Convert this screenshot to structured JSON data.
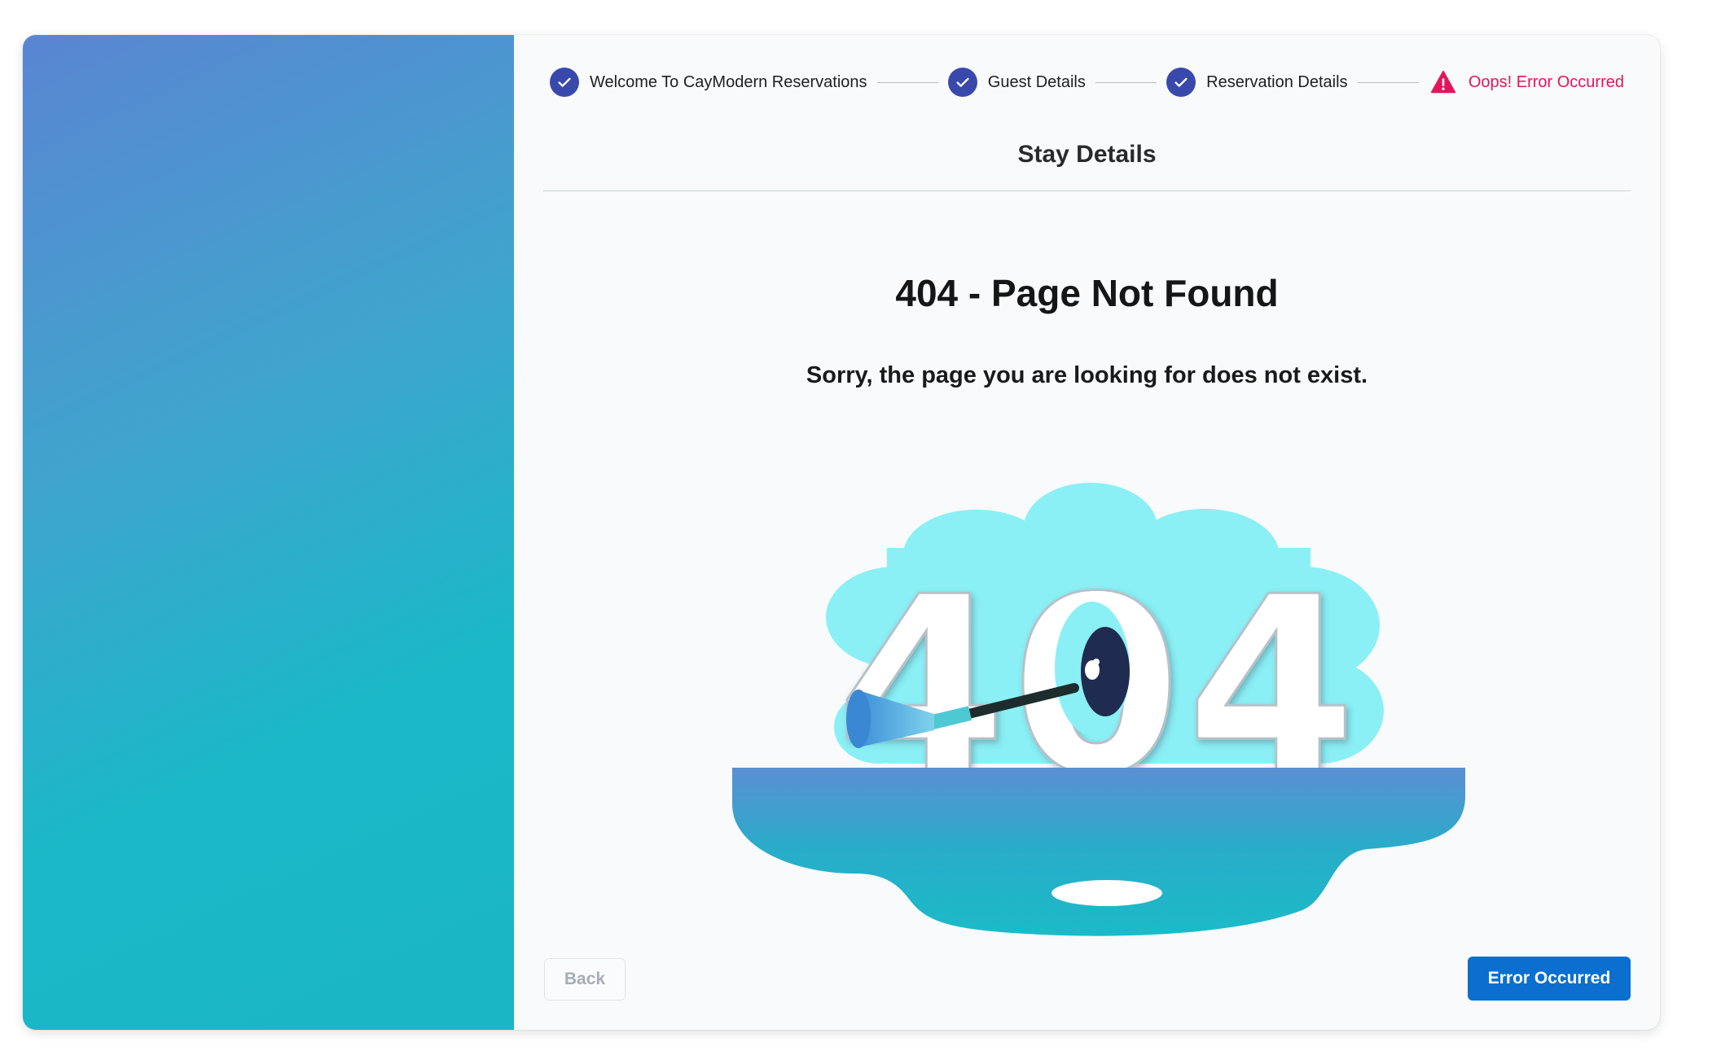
{
  "stepper": {
    "steps": [
      {
        "label": "Welcome To CayModern Reservations",
        "status": "complete",
        "icon": "check-icon"
      },
      {
        "label": "Guest Details",
        "status": "complete",
        "icon": "check-icon"
      },
      {
        "label": "Reservation Details",
        "status": "complete",
        "icon": "check-icon"
      },
      {
        "label": "Oops! Error Occurred",
        "status": "error",
        "icon": "warning-icon"
      }
    ]
  },
  "main": {
    "section_title": "Stay Details",
    "error_heading": "404 - Page Not Found",
    "error_message": "Sorry, the page you are looking for does not exist.",
    "illustration_text": "404"
  },
  "footer": {
    "back_label": "Back",
    "primary_label": "Error Occurred"
  },
  "colors": {
    "step_complete": "#3949ab",
    "step_error": "#e3165b",
    "primary_button": "#0b6fd0",
    "sidebar_gradient_start": "#5a85d2",
    "sidebar_gradient_end": "#1bb6c6"
  }
}
